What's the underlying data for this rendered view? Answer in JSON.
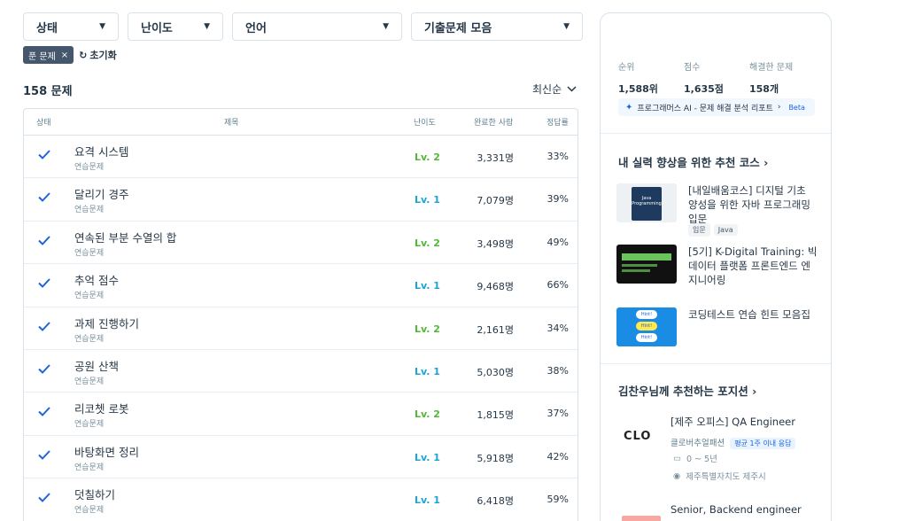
{
  "filters": [
    {
      "label": "상태"
    },
    {
      "label": "난이도"
    },
    {
      "label": "언어"
    },
    {
      "label": "기출문제 모음"
    }
  ],
  "active_chip": {
    "label": "푼 문제",
    "close": "×"
  },
  "reset_label": "초기화",
  "problem_count": "158 문제",
  "sort_label": "최신순",
  "table": {
    "headers": [
      "상태",
      "제목",
      "난이도",
      "완료한 사람",
      "정답률"
    ],
    "rows": [
      {
        "title": "요격 시스템",
        "category": "연습문제",
        "level": "Lv. 2",
        "completed": "3,331명",
        "rate": "33%"
      },
      {
        "title": "달리기 경주",
        "category": "연습문제",
        "level": "Lv. 1",
        "completed": "7,079명",
        "rate": "39%"
      },
      {
        "title": "연속된 부분 수열의 합",
        "category": "연습문제",
        "level": "Lv. 2",
        "completed": "3,498명",
        "rate": "49%"
      },
      {
        "title": "추억 점수",
        "category": "연습문제",
        "level": "Lv. 1",
        "completed": "9,468명",
        "rate": "66%"
      },
      {
        "title": "과제 진행하기",
        "category": "연습문제",
        "level": "Lv. 2",
        "completed": "2,161명",
        "rate": "34%"
      },
      {
        "title": "공원 산책",
        "category": "연습문제",
        "level": "Lv. 1",
        "completed": "5,030명",
        "rate": "38%"
      },
      {
        "title": "리코쳇 로봇",
        "category": "연습문제",
        "level": "Lv. 2",
        "completed": "1,815명",
        "rate": "37%"
      },
      {
        "title": "바탕화면 정리",
        "category": "연습문제",
        "level": "Lv. 1",
        "completed": "5,918명",
        "rate": "42%"
      },
      {
        "title": "덧칠하기",
        "category": "연습문제",
        "level": "Lv. 1",
        "completed": "6,418명",
        "rate": "59%"
      }
    ]
  },
  "profile": {
    "stats": [
      {
        "label": "순위",
        "value": "1,588위"
      },
      {
        "label": "점수",
        "value": "1,635점"
      },
      {
        "label": "해결한 문제",
        "value": "158개"
      }
    ],
    "ai_report": "프로그래머스 AI - 문제 해결 분석 리포트",
    "ai_beta": "Beta"
  },
  "courses_section": {
    "title": "내 실력 향상을 위한 추천 코스",
    "courses": [
      {
        "title": "[내일배움코스] 디지털 기초 양성을 위한 자바 프로그래밍 입문",
        "tags": [
          "입문",
          "Java"
        ],
        "thumb_text": "Java Programming"
      },
      {
        "title": "[5기] K-Digital Training: 빅데이터 플랫폼 프론트엔드 엔지니어링",
        "tags": []
      },
      {
        "title": "코딩테스트 연습 힌트 모음집",
        "tags": [],
        "thumb_text": "Hint!"
      }
    ]
  },
  "positions_section": {
    "title": "김찬우님께 추천하는 포지션",
    "positions": [
      {
        "title": "[제주 오피스] QA Engineer",
        "company": "클로버추얼패션",
        "badge": "평균 1주 이내 응답",
        "experience": "0 ~ 5년",
        "location": "제주특별자치도 제주시",
        "logo": "CLO"
      },
      {
        "title": "Senior, Backend engineer"
      }
    ]
  },
  "colors": {
    "lv1": "#1ba4d8",
    "lv2": "#52b936",
    "check": "#1b64da",
    "chip": "#44576c"
  }
}
